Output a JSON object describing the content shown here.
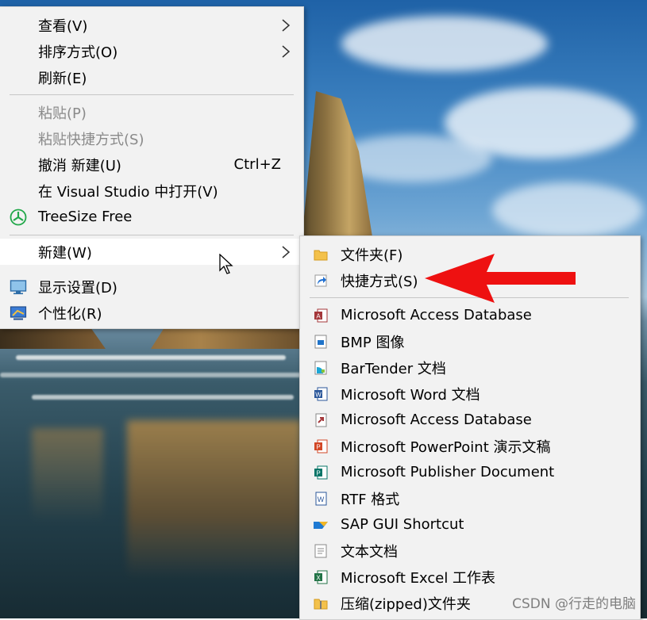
{
  "context_menu": {
    "items": [
      {
        "label": "查看(V)"
      },
      {
        "label": "排序方式(O)"
      },
      {
        "label": "刷新(E)"
      },
      {
        "label": "粘贴(P)"
      },
      {
        "label": "粘贴快捷方式(S)"
      },
      {
        "label": "撤消 新建(U)",
        "shortcut": "Ctrl+Z"
      },
      {
        "label": "在 Visual Studio 中打开(V)"
      },
      {
        "label": "TreeSize Free"
      },
      {
        "label": "新建(W)"
      },
      {
        "label": "显示设置(D)"
      },
      {
        "label": "个性化(R)"
      }
    ]
  },
  "new_submenu": {
    "items": [
      {
        "label": "文件夹(F)"
      },
      {
        "label": "快捷方式(S)"
      },
      {
        "label": "Microsoft Access Database"
      },
      {
        "label": "BMP 图像"
      },
      {
        "label": "BarTender 文档"
      },
      {
        "label": "Microsoft Word 文档"
      },
      {
        "label": "Microsoft Access Database"
      },
      {
        "label": "Microsoft PowerPoint 演示文稿"
      },
      {
        "label": "Microsoft Publisher Document"
      },
      {
        "label": "RTF 格式"
      },
      {
        "label": "SAP GUI Shortcut"
      },
      {
        "label": "文本文档"
      },
      {
        "label": "Microsoft Excel 工作表"
      },
      {
        "label": "压缩(zipped)文件夹"
      }
    ]
  },
  "watermark": "CSDN @行走的电脑",
  "colors": {
    "arrow": "#ee1111",
    "menu_bg": "#f2f2f2",
    "highlight": "#ffffff"
  }
}
